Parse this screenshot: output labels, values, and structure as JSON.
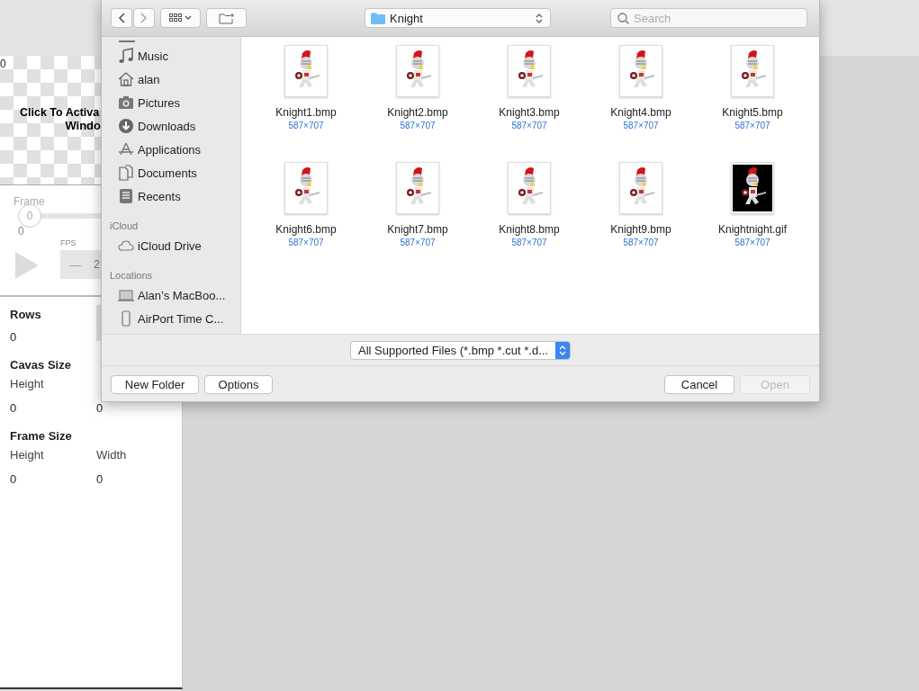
{
  "app": {
    "canvas_corner": "0",
    "canvas_message": [
      "Click To Activa",
      "Windo"
    ],
    "frame": {
      "label": "Frame",
      "knob": "0",
      "min": "0",
      "level": 0
    },
    "fps": {
      "label": "FPS",
      "minus": "—",
      "value": "2"
    },
    "rows": {
      "label": "Rows",
      "value": "0"
    },
    "canvas_size": {
      "title": "Cavas Size",
      "labels": [
        "Height"
      ],
      "values": [
        "0",
        "0"
      ]
    },
    "frame_size": {
      "title": "Frame Size",
      "labels": [
        "Height",
        "Width"
      ],
      "values": [
        "0",
        "0"
      ]
    }
  },
  "dialog": {
    "location": "Knight",
    "search": {
      "placeholder": "Search"
    },
    "sidebar": [
      {
        "items": [
          "Music",
          "alan",
          "Pictures",
          "Downloads",
          "Applications",
          "Documents",
          "Recents"
        ]
      },
      {
        "heading": "iCloud",
        "items": [
          "iCloud Drive"
        ]
      },
      {
        "heading": "Locations",
        "items": [
          "Alan’s MacBoo...",
          "AirPort Time C..."
        ]
      }
    ],
    "files": [
      {
        "name": "Knight1.bmp",
        "size": "587×707",
        "color": "#ffffff"
      },
      {
        "name": "Knight2.bmp",
        "size": "587×707",
        "color": "#ffffff"
      },
      {
        "name": "Knight3.bmp",
        "size": "587×707",
        "color": "#ffffff"
      },
      {
        "name": "Knight4.bmp",
        "size": "587×707",
        "color": "#ffffff"
      },
      {
        "name": "Knight5.bmp",
        "size": "587×707",
        "color": "#ffffff"
      },
      {
        "name": "Knight6.bmp",
        "size": "587×707",
        "color": "#ffffff"
      },
      {
        "name": "Knight7.bmp",
        "size": "587×707",
        "color": "#ffffff"
      },
      {
        "name": "Knight8.bmp",
        "size": "587×707",
        "color": "#ffffff"
      },
      {
        "name": "Knight9.bmp",
        "size": "587×707",
        "color": "#ffffff"
      },
      {
        "name": "Knightnight.gif",
        "size": "587×707",
        "color": "#000000"
      }
    ],
    "filter": "All Supported Files (*.bmp *.cut *.d...",
    "buttons": [
      {
        "label": "New Folder",
        "disabled": false
      },
      {
        "label": "Options",
        "disabled": false
      },
      {
        "label": "Cancel",
        "disabled": false
      },
      {
        "label": "Open",
        "disabled": true
      }
    ]
  }
}
